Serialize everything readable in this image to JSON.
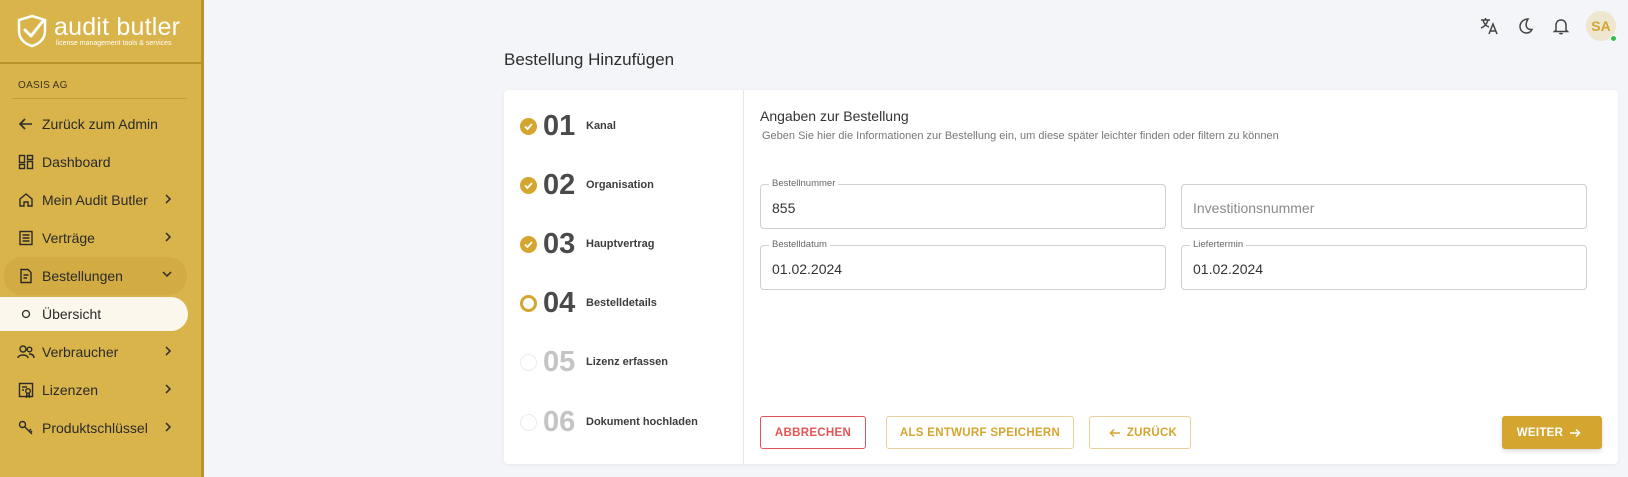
{
  "brand": {
    "name": "audit butler",
    "tagline": "license management tools & services",
    "primary": "#d9b44a",
    "accent": "#d4a62f",
    "danger": "#e55454"
  },
  "sidebar": {
    "org": "OASIS AG",
    "items": [
      {
        "label": "Zurück zum Admin",
        "icon": "arrow-left-icon"
      },
      {
        "label": "Dashboard",
        "icon": "dashboard-icon"
      },
      {
        "label": "Mein Audit Butler",
        "icon": "home-icon"
      },
      {
        "label": "Verträge",
        "icon": "list-icon"
      },
      {
        "label": "Bestellungen",
        "icon": "order-icon"
      },
      {
        "label": "Übersicht",
        "icon": "circle-icon"
      },
      {
        "label": "Verbraucher",
        "icon": "users-icon"
      },
      {
        "label": "Lizenzen",
        "icon": "license-icon"
      },
      {
        "label": "Produktschlüssel",
        "icon": "key-icon"
      }
    ]
  },
  "topbar": {
    "avatar_initials": "SA"
  },
  "page": {
    "title": "Bestellung Hinzufügen"
  },
  "steps": [
    {
      "num": "01",
      "label": "Kanal",
      "state": "done"
    },
    {
      "num": "02",
      "label": "Organisation",
      "state": "done"
    },
    {
      "num": "03",
      "label": "Hauptvertrag",
      "state": "done"
    },
    {
      "num": "04",
      "label": "Bestelldetails",
      "state": "current"
    },
    {
      "num": "05",
      "label": "Lizenz erfassen",
      "state": "todo"
    },
    {
      "num": "06",
      "label": "Dokument hochladen",
      "state": "todo"
    }
  ],
  "form": {
    "title": "Angaben zur Bestellung",
    "subtitle": "Geben Sie hier die Informationen zur Bestellung ein, um diese später leichter finden oder filtern zu können",
    "fields": {
      "order_number": {
        "label": "Bestellnummer",
        "value": "855"
      },
      "investment_number": {
        "placeholder": "Investitionsnummer"
      },
      "order_date": {
        "label": "Bestelldatum",
        "value": "01.02.2024"
      },
      "delivery_date": {
        "label": "Liefertermin",
        "value": "01.02.2024"
      }
    }
  },
  "buttons": {
    "cancel": "ABBRECHEN",
    "draft": "ALS ENTWURF SPEICHERN",
    "back": "ZURÜCK",
    "next": "WEITER"
  }
}
